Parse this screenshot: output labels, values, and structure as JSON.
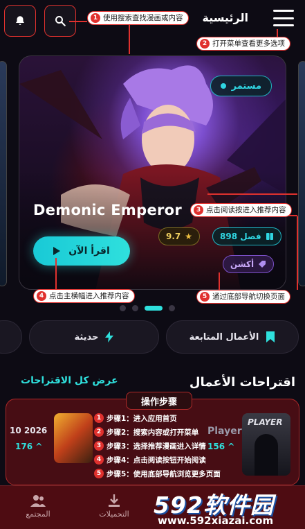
{
  "header": {
    "title": "الرئيسية"
  },
  "hero": {
    "status": "مستمر",
    "title": "Demonic Emperor",
    "read_label": "اقرأ الآن",
    "rating": "9.7",
    "chapters": "898 فصل",
    "genre": "أكشن",
    "pages_total": 4,
    "page_active": 3
  },
  "callouts": {
    "c1": "使用搜索查找漫画或内容",
    "c2": "打开菜单查看更多选项",
    "c3": "点击阅读按进入推荐内容",
    "c4": "点击主横幅进入推荐内容",
    "c5": "通过底部导航切换页面"
  },
  "tabs": {
    "following": "الأعمال المتابعة",
    "recent": "حديثة"
  },
  "section": {
    "title": "اقتراحات الأعمال",
    "view_all": "عرض كل الاقتراحات"
  },
  "rec": {
    "left_date": "10 2026",
    "left_count": "176",
    "right_label": "Player",
    "right_count": "156",
    "right_thumb_text": "PLAYER"
  },
  "steps": {
    "title": "操作步骤",
    "items": [
      "步骤1：进入应用首页",
      "步骤2：搜索内容或打开菜单",
      "步骤3：选择推荐漫画进入详情",
      "步骤4：点击阅读按钮开始阅读",
      "步骤5：使用底部导航浏览更多页面"
    ]
  },
  "bottom_nav": {
    "community": "المجتمع",
    "downloads": "التحميلات"
  },
  "watermark": {
    "brand": "592软件园",
    "url": "www.592xiazai.com"
  },
  "colors": {
    "accent": "#2fe0dd",
    "annotation": "#e0312e",
    "background": "#0d0b14"
  }
}
